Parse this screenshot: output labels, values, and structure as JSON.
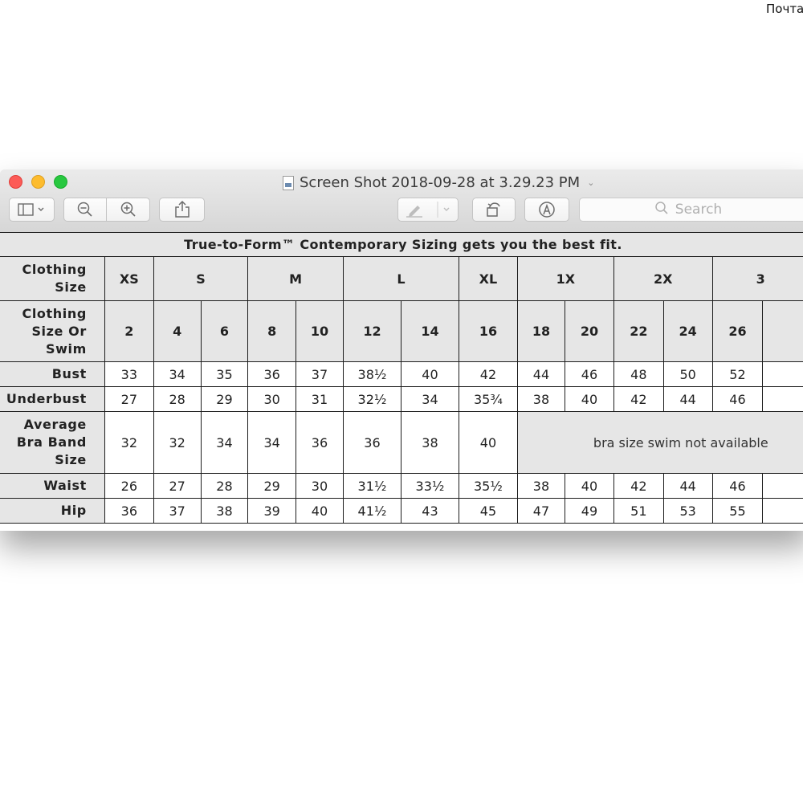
{
  "corner_text": "Почта",
  "window": {
    "title": "Screen Shot 2018-09-28 at 3.29.23 PM",
    "search_placeholder": "Search"
  },
  "toolbar": {
    "icons": [
      "sidebar-icon",
      "chevron-down-icon",
      "zoom-out-icon",
      "zoom-in-icon",
      "share-icon",
      "markup-pen-icon",
      "rotate-icon",
      "annotate-icon",
      "search-icon"
    ]
  },
  "table": {
    "title": "True-to-Form™ Contemporary Sizing gets you the best fit.",
    "row_headers": {
      "clothing_size": "Clothing Size",
      "swim": "Clothing Size Or Swim",
      "bust": "Bust",
      "underbust": "Underbust",
      "bra_band": "Average Bra Band Size",
      "waist": "Waist",
      "hip": "Hip"
    },
    "size_groups": [
      "XS",
      "S",
      "M",
      "L",
      "XL",
      "1X",
      "2X",
      "3"
    ],
    "numeric_sizes": [
      "2",
      "4",
      "6",
      "8",
      "10",
      "12",
      "14",
      "16",
      "18",
      "20",
      "22",
      "24",
      "26"
    ],
    "bust": [
      "33",
      "34",
      "35",
      "36",
      "37",
      "38½",
      "40",
      "42",
      "44",
      "46",
      "48",
      "50",
      "52"
    ],
    "underbust": [
      "27",
      "28",
      "29",
      "30",
      "31",
      "32½",
      "34",
      "35¾",
      "38",
      "40",
      "42",
      "44",
      "46"
    ],
    "bra_band": [
      "32",
      "32",
      "34",
      "34",
      "36",
      "36",
      "38",
      "40"
    ],
    "bra_unavailable": "bra size swim not available",
    "waist": [
      "26",
      "27",
      "28",
      "29",
      "30",
      "31½",
      "33½",
      "35½",
      "38",
      "40",
      "42",
      "44",
      "46"
    ],
    "hip": [
      "36",
      "37",
      "38",
      "39",
      "40",
      "41½",
      "43",
      "45",
      "47",
      "49",
      "51",
      "53",
      "55"
    ]
  }
}
